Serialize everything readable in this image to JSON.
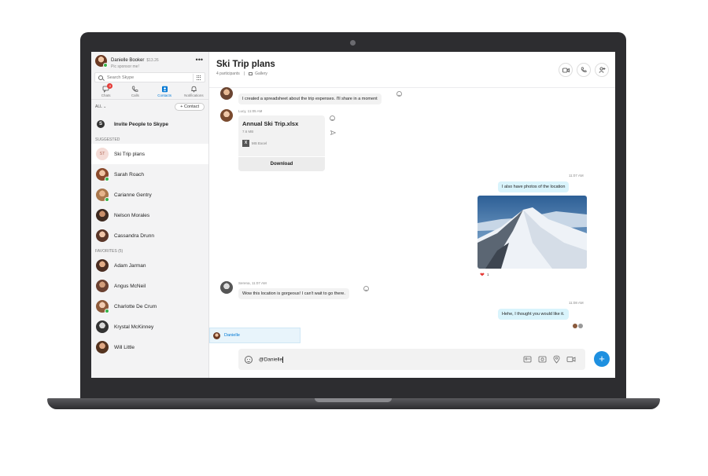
{
  "profile": {
    "name": "Danielle Booker",
    "credit": "$13.26",
    "status": "Pic sponsor me!"
  },
  "search": {
    "placeholder": "Search Skype"
  },
  "tabs": [
    {
      "label": "Chats",
      "badge": "3"
    },
    {
      "label": "Calls"
    },
    {
      "label": "Contacts"
    },
    {
      "label": "Notifications"
    }
  ],
  "filter": {
    "label": "ALL",
    "contact_button": "+ Contact"
  },
  "invite": {
    "label": "Invite People to Skype"
  },
  "sections": {
    "suggested": "SUGGESTED",
    "favorites": "FAVORITES (5)"
  },
  "suggested": [
    {
      "initials": "ST",
      "name": "Ski Trip plans"
    },
    {
      "name": "Sarah Roach"
    },
    {
      "name": "Carianne Gentry"
    },
    {
      "name": "Nelson Morales"
    },
    {
      "name": "Cassandra Drunn"
    }
  ],
  "favorites": [
    {
      "name": "Adam Jarman"
    },
    {
      "name": "Angus McNeil"
    },
    {
      "name": "Charlotte De Crum"
    },
    {
      "name": "Krystal McKinney"
    },
    {
      "name": "Will Little"
    }
  ],
  "chat": {
    "title": "Ski Trip plans",
    "participants": "4 participants",
    "separator": "|",
    "gallery": "Gallery"
  },
  "messages": {
    "m1_text": "I created a spreadsheet about the trip expenses. I'll share in a moment",
    "m2_meta": "Lucy, 11:05 AM",
    "file": {
      "name": "Annual Ski Trip.xlsx",
      "size": "7.6 MB",
      "type": "MS Excel",
      "download": "Download"
    },
    "m3_time": "11:07 AM",
    "m3_text": "I also have photos of the location",
    "heart_count": "1",
    "m4_meta": "Serena, 11:07 AM",
    "m4_text": "Wow this location is gorgeous! I can't wait to go there.",
    "m5_time": "11:08 AM",
    "m5_text": "Hehe, I thought you would like it."
  },
  "mention": {
    "name": "Danielle"
  },
  "composer": {
    "text": "@Danielle"
  },
  "colors": {
    "accent": "#0078d4",
    "outgoing_bubble": "#d9f4fc",
    "incoming_bubble": "#f2f2f2",
    "online": "#37b34a",
    "badge": "#e53935"
  }
}
